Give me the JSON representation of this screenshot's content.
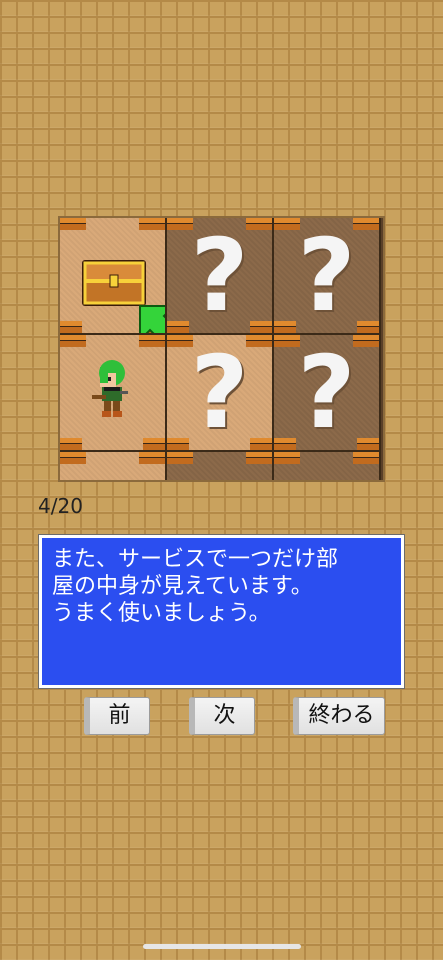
{
  "board": {
    "tiles": [
      {
        "state": "open",
        "content": "treasure-chest"
      },
      {
        "state": "closed",
        "label": "?"
      },
      {
        "state": "closed",
        "label": "?"
      },
      {
        "state": "open",
        "content": "player-character"
      },
      {
        "state": "open",
        "label": "?"
      },
      {
        "state": "closed",
        "label": "?"
      }
    ],
    "hint_arrow_color": "#34d43a"
  },
  "progress": "4/20",
  "message": "また、サービスで一つだけ部\n屋の中身が見えています。\nうまく使いましょう。",
  "buttons": {
    "prev": "前",
    "next": "次",
    "end": "終わる"
  },
  "colors": {
    "message_bg": "#2b4ef0",
    "background": "#c9a25e"
  }
}
